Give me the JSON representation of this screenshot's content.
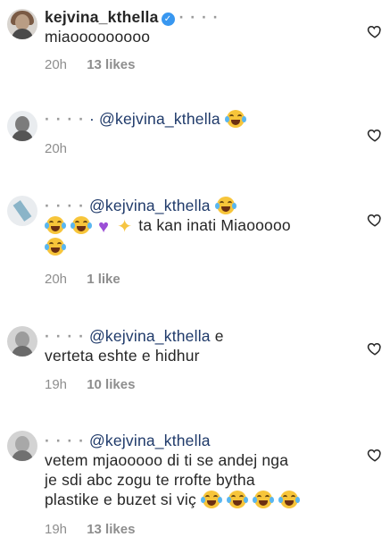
{
  "comments": [
    {
      "username": "kejvina_kthella",
      "blur_suffix": "· · · ·",
      "text": "miaooooooooo",
      "time": "20h",
      "likes": "13 likes"
    },
    {
      "username": "· · · ·",
      "mention": "· @kejvina_kthella",
      "time": "20h"
    },
    {
      "username": "· · · ·",
      "mention": "@kejvina_kthella",
      "text": "ta kan inati Miaooooo",
      "time": "20h",
      "likes": "1 like"
    },
    {
      "username": "· · · ·",
      "mention": "@kejvina_kthella",
      "text_line1": "e",
      "text_line2": "verteta eshte e hidhur",
      "time": "19h",
      "likes": "10 likes"
    },
    {
      "username": "· · · ·",
      "mention": "@kejvina_kthella",
      "text_line1": "vetem mjaooooo di ti se andej nga",
      "text_line2": "je sdi abc zogu te rrofte bytha",
      "text_line3": "plastike e buzet si viç",
      "time": "19h",
      "likes": "13 likes"
    }
  ],
  "icons": {
    "like": "heart-outline-icon",
    "verified": "verified-badge-icon"
  }
}
